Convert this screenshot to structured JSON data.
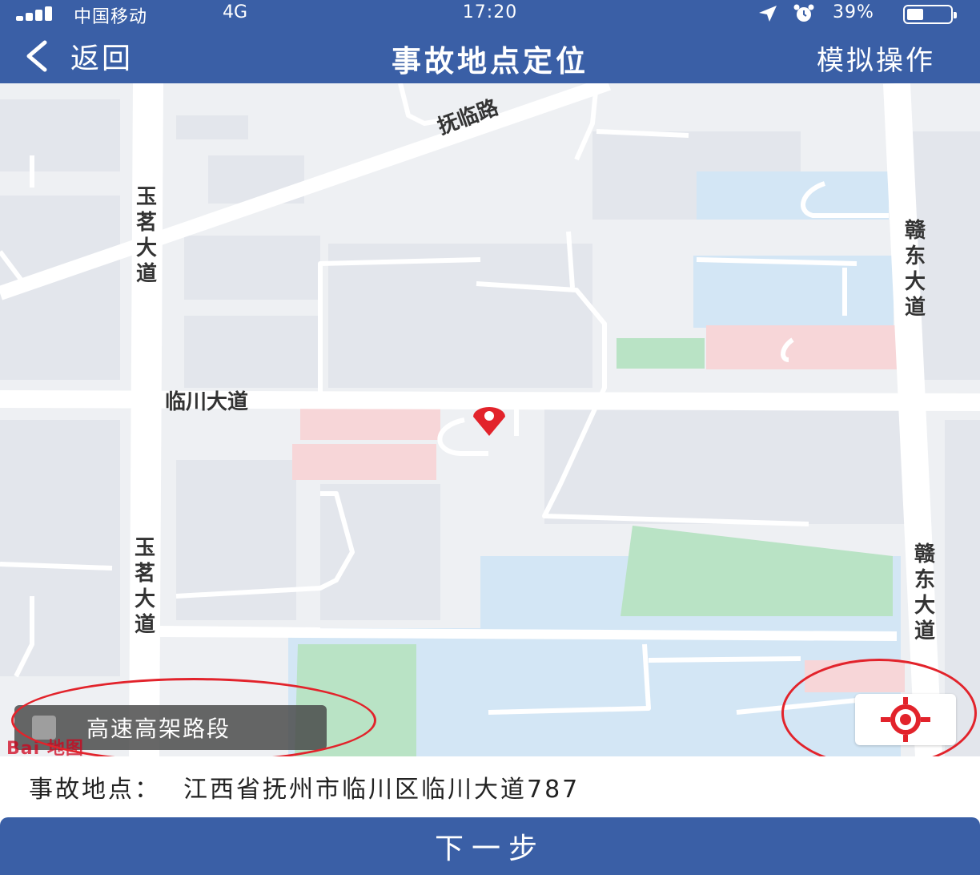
{
  "status_bar": {
    "carrier": "中国移动",
    "network": "4G",
    "time": "17:20",
    "battery": "39%"
  },
  "nav": {
    "back_label": "返回",
    "title": "事故地点定位",
    "action_label": "模拟操作"
  },
  "map": {
    "road_labels": {
      "fulin": "抚临路",
      "yuming_top": "玉茗大道",
      "yuming_bottom": "玉茗大道",
      "gandong_top": "赣东大道",
      "gandong_bottom": "赣东大道",
      "linchuan": "临川大道"
    },
    "highway_toggle_label": "高速高架路段",
    "provider_logo_text": "Bai 地图",
    "pin_icon": "map-pin-icon",
    "locate_icon": "crosshair-icon"
  },
  "accident": {
    "label": "事故地点：",
    "address": "江西省抚州市临川区临川大道787"
  },
  "footer": {
    "next_label": "下一步"
  },
  "colors": {
    "nav_blue": "#3a5fa6",
    "highlight_red": "#e2232b",
    "map_background": "#eef0f3",
    "water": "#d3e6f5",
    "green_area": "#b9e3c5",
    "pink_area": "#f7d6d8"
  }
}
